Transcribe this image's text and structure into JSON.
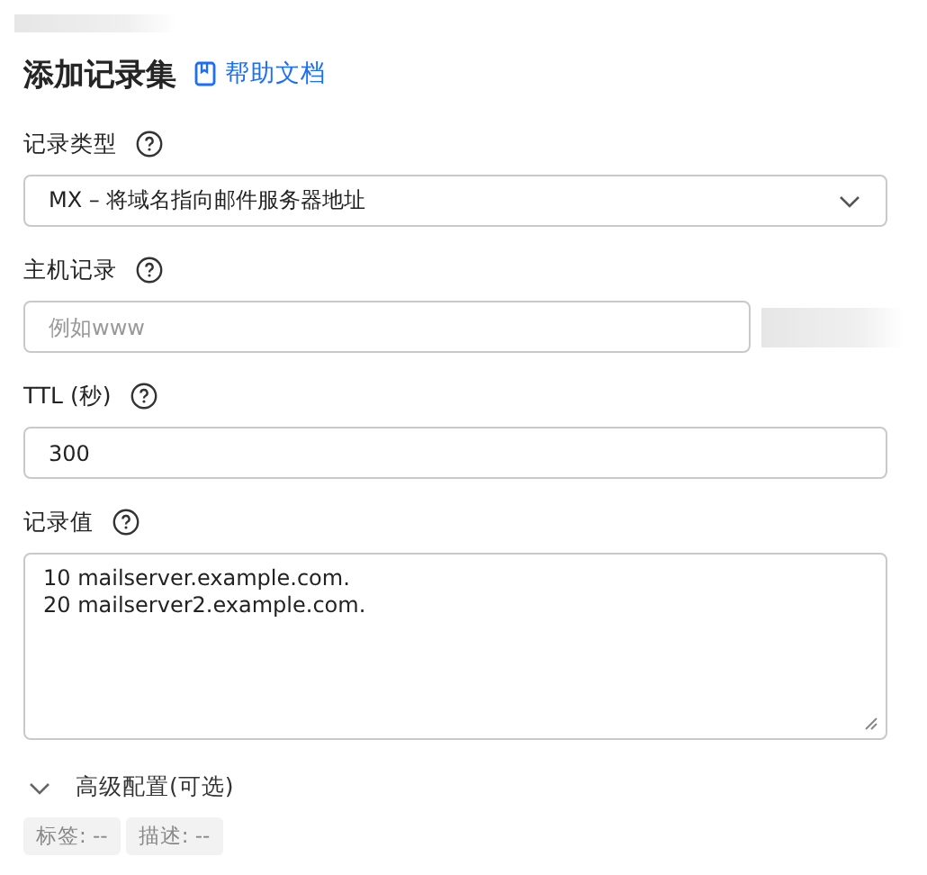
{
  "title": "添加记录集",
  "help_link": "帮助文档",
  "fields": [
    {
      "kind": "select",
      "label": "记录类型",
      "value": "MX – 将域名指向邮件服务器地址"
    },
    {
      "kind": "input_suffix",
      "label": "主机记录",
      "placeholder": "例如www"
    },
    {
      "kind": "input",
      "label": "TTL (秒)",
      "value": "300"
    },
    {
      "kind": "textarea",
      "label": "记录值",
      "lines": [
        "10 mailserver.example.com.",
        "20 mailserver2.example.com."
      ]
    }
  ],
  "advanced": {
    "label": "高级配置(可选)",
    "expanded": false
  },
  "tags": [
    "标签: --",
    "描述: --"
  ]
}
